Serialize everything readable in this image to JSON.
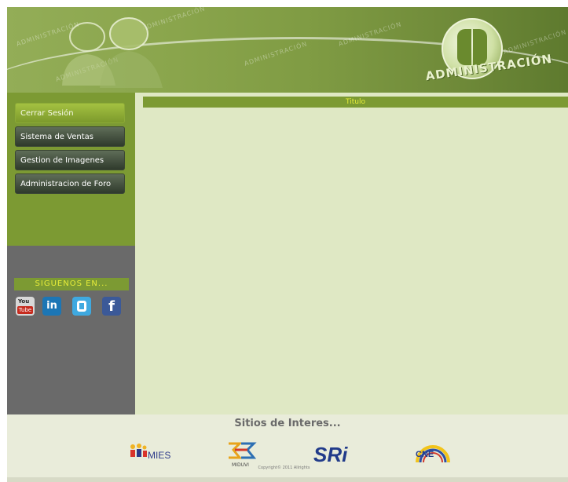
{
  "header": {
    "brand_text": "ADMINISTRACIÓN",
    "watermark_text": "ADMINISTRACIÓN"
  },
  "sidebar": {
    "items": [
      {
        "label": "Cerrar Sesión",
        "active": true
      },
      {
        "label": "Sistema de Ventas",
        "active": false
      },
      {
        "label": "Gestion de Imagenes",
        "active": false
      },
      {
        "label": "Administracion de Foro",
        "active": false
      }
    ],
    "follow_label": "SIGUENOS EN...",
    "social": [
      {
        "name": "youtube-icon",
        "text_top": "You",
        "text_bottom": "Tube"
      },
      {
        "name": "linkedin-icon",
        "text": "in"
      },
      {
        "name": "twitter-icon"
      },
      {
        "name": "facebook-icon",
        "text": "f"
      }
    ]
  },
  "main": {
    "title": "Titulo"
  },
  "footer": {
    "sites_title": "Sitios de Interes...",
    "logos": [
      {
        "name": "mies-logo",
        "text": "MIES"
      },
      {
        "name": "miduvi-logo",
        "text": "MIDUVI"
      },
      {
        "name": "sri-logo",
        "text": "SRi"
      },
      {
        "name": "cne-logo",
        "text": "CNE"
      }
    ],
    "copyright": "Copyright© 2011 Allrights"
  },
  "colors": {
    "accent_green": "#7c9a33",
    "title_text_yellow": "#e6ec3a",
    "content_bg": "#dfe8c4",
    "sidebar_gray": "#6a6a6a"
  }
}
